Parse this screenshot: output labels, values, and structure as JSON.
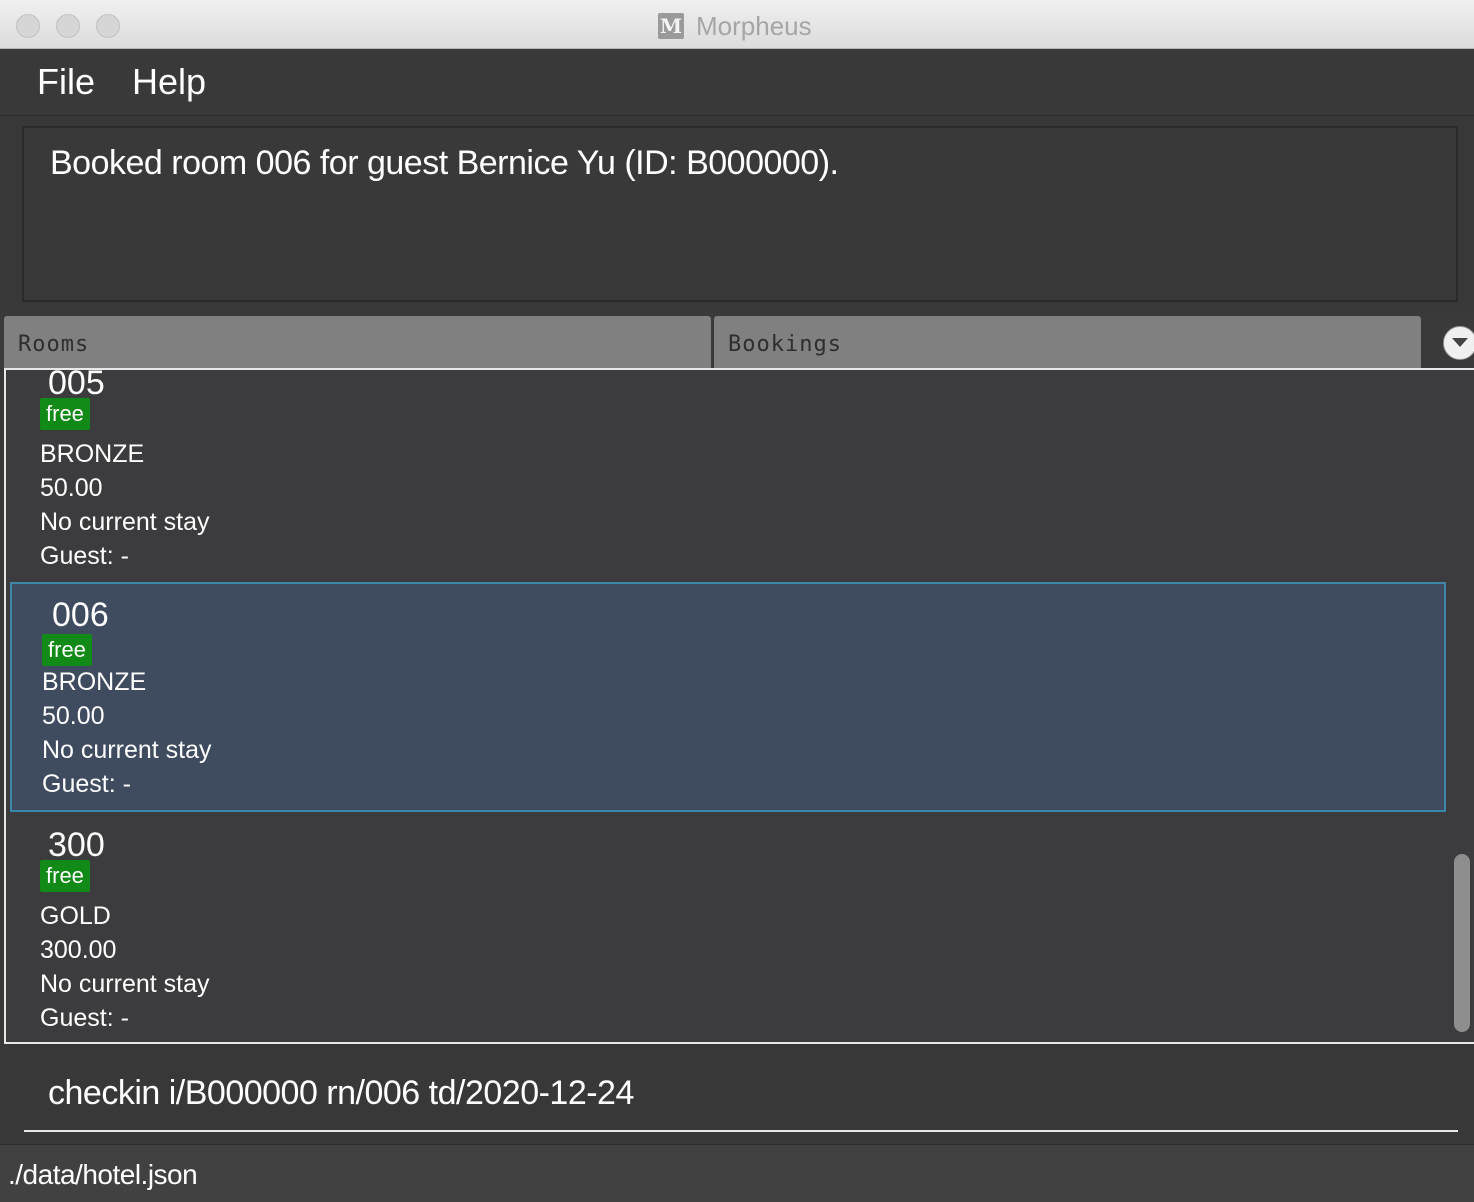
{
  "window": {
    "title": "Morpheus",
    "app_icon_letter": "M"
  },
  "menu": {
    "file": "File",
    "help": "Help"
  },
  "result": {
    "message": "Booked room 006 for guest Bernice Yu (ID: B000000)."
  },
  "tabs": [
    {
      "label": "Rooms"
    },
    {
      "label": "Bookings"
    }
  ],
  "rooms": [
    {
      "number": "005",
      "status": "free",
      "tier": "BRONZE",
      "price": "50.00",
      "stay": "No current stay",
      "guest": "Guest: -"
    },
    {
      "number": "006",
      "status": "free",
      "tier": "BRONZE",
      "price": "50.00",
      "stay": "No current stay",
      "guest": "Guest: -"
    },
    {
      "number": "300",
      "status": "free",
      "tier": "GOLD",
      "price": "300.00",
      "stay": "No current stay",
      "guest": "Guest: -"
    }
  ],
  "command": {
    "value": "checkin i/B000000 rn/006 td/2020-12-24"
  },
  "status": {
    "path": "./data/hotel.json"
  },
  "colors": {
    "badge_free": "#128a17",
    "selected_bg": "#3f4b5e",
    "selected_border": "#3d87a8"
  }
}
